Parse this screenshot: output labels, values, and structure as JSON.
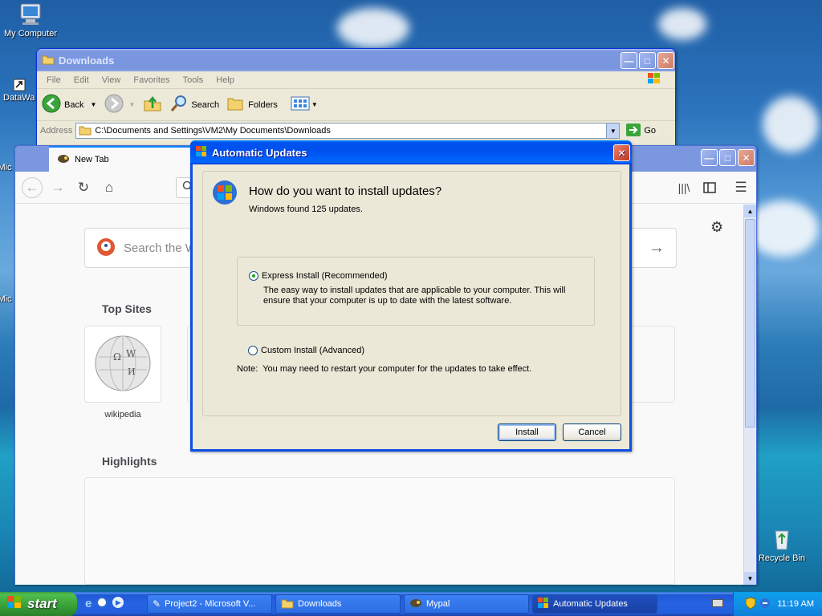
{
  "desktop": {
    "icons": [
      {
        "label": "My Computer"
      },
      {
        "label": "DataWa"
      },
      {
        "label": "Mic"
      },
      {
        "label": "Mic"
      },
      {
        "label": "Recycle Bin"
      }
    ]
  },
  "explorer": {
    "title": "Downloads",
    "menu": [
      "File",
      "Edit",
      "View",
      "Favorites",
      "Tools",
      "Help"
    ],
    "toolbar": {
      "back": "Back",
      "search": "Search",
      "folders": "Folders"
    },
    "address_label": "Address",
    "address_value": "C:\\Documents and Settings\\VM2\\My Documents\\Downloads",
    "go": "Go"
  },
  "firefox": {
    "tab_title": "New Tab",
    "search_placeholder": "Search the W",
    "top_sites_heading": "Top Sites",
    "top_site": {
      "label": "wikipedia"
    },
    "highlights_heading": "Highlights"
  },
  "dialog": {
    "title": "Automatic Updates",
    "heading": "How do you want to install updates?",
    "subtext": "Windows found 125 updates.",
    "express_label": "Express Install (Recommended)",
    "express_desc_line1": "The easy way to install updates that are applicable to your computer. This will",
    "express_desc_line2": "ensure that your computer is up to date with the latest software.",
    "custom_label": "Custom Install (Advanced)",
    "note": "Note:  You may need to restart your computer for the updates to take effect.",
    "install_button": "Install",
    "cancel_button": "Cancel"
  },
  "taskbar": {
    "start": "start",
    "tasks": [
      {
        "label": "Project2 - Microsoft V..."
      },
      {
        "label": "Downloads"
      },
      {
        "label": "Mypal"
      },
      {
        "label": "Automatic Updates"
      }
    ],
    "clock": "11:19 AM"
  }
}
